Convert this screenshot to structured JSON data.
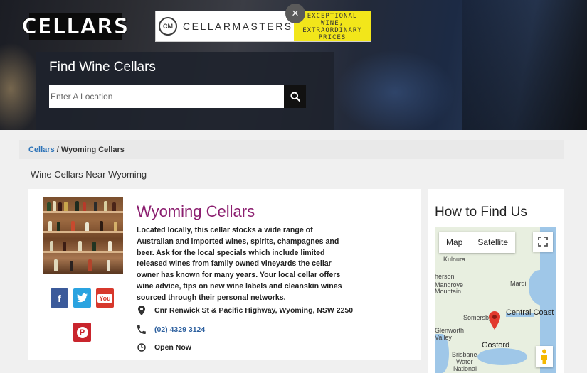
{
  "header": {
    "logo_text": "CELLARS",
    "ad": {
      "badge": "CM",
      "brand": "CELLARMASTERS",
      "tagline_lines": [
        "EXCEPTIONAL",
        "WINE,",
        "EXTRAORDINARY",
        "PRICES"
      ],
      "close_glyph": "×"
    },
    "search": {
      "title": "Find Wine Cellars",
      "placeholder": "Enter A Location"
    }
  },
  "breadcrumb": {
    "link": "Cellars",
    "separator": " / ",
    "current": "Wyoming Cellars"
  },
  "section_heading": "Wine Cellars Near Wyoming",
  "listing": {
    "title": "Wyoming Cellars",
    "description": "Located locally, this cellar stocks a wide range of Australian and imported wines, spirits, champagnes and beer. Ask for the local specials which include limited released wines from family owned vineyards the cellar owner has known for many years. Your local cellar offers wine advice, tips on new wine labels and cleanskin wines sourced through their personal networks.",
    "address": "Cnr Renwick St & Pacific Highway, Wyoming, NSW 2250",
    "phone": "(02) 4329 3124",
    "hours": "Open Now",
    "social": {
      "facebook": "f",
      "twitter": "t",
      "youtube": "You",
      "pinterest": "P"
    }
  },
  "map_panel": {
    "title": "How to Find Us",
    "tab_map": "Map",
    "tab_satellite": "Satellite",
    "labels": {
      "kulnura": "Kulnura",
      "herson": "herson",
      "mangrove": "Mangrove",
      "mountain": "Mountain",
      "mardi": "Mardi",
      "somersby": "Somersby",
      "central_coast": "Central Coast",
      "glenworth": "Glenworth",
      "valley": "Valley",
      "gosford": "Gosford",
      "brisbane_water": "Brisbane",
      "water": "Water",
      "national": "National"
    }
  }
}
